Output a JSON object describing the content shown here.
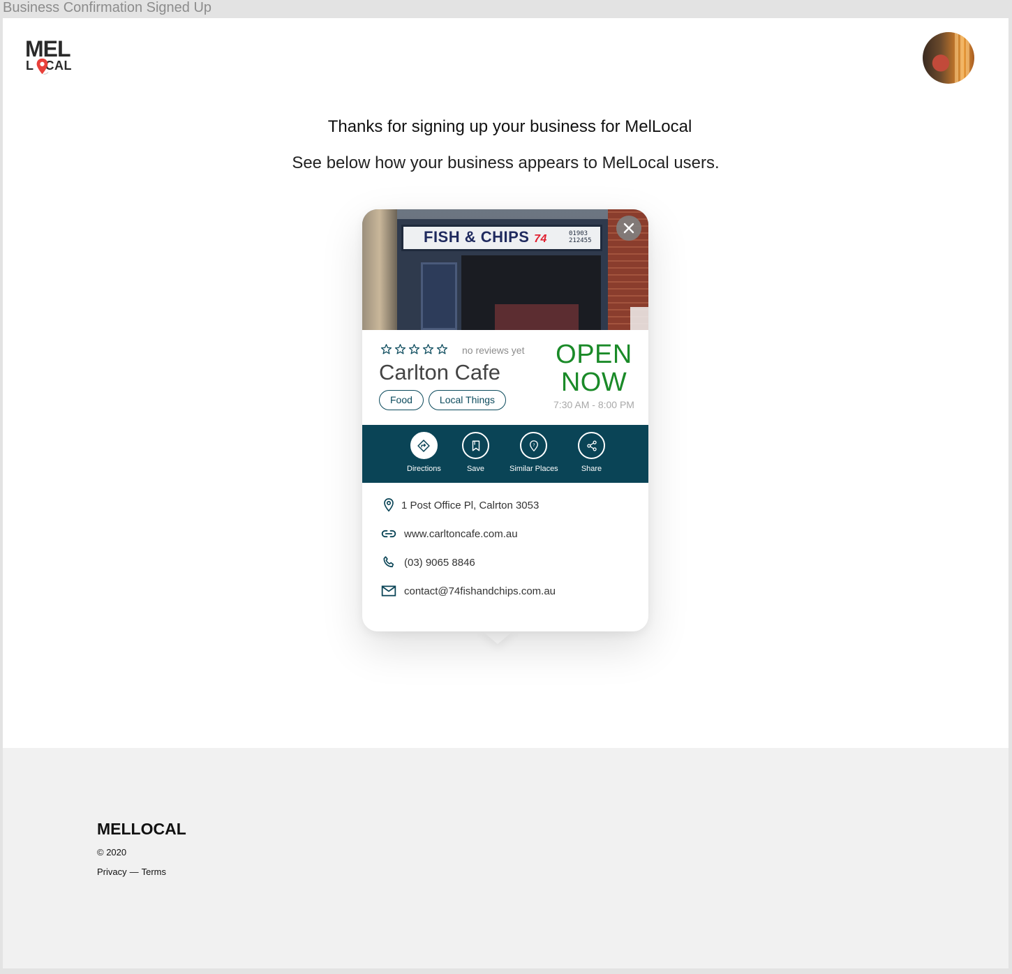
{
  "frame": {
    "title": "Business Confirmation Signed Up"
  },
  "header": {
    "logo": {
      "line1": "MEL",
      "line2_a": "L",
      "line2_b": "CAL",
      "pin_color": "#e8403a"
    }
  },
  "intro": {
    "heading": "Thanks for signing up your business for MelLocal",
    "subheading": "See below how your business appears to MelLocal users."
  },
  "card": {
    "photo": {
      "sign_text": "FISH & CHIPS",
      "sign_number": "74",
      "sign_phone_1": "01903",
      "sign_phone_2": "212455"
    },
    "rating": {
      "stars": 0,
      "max_stars": 5,
      "label": "no reviews yet"
    },
    "name": "Carlton Cafe",
    "tags": [
      "Food",
      "Local Things"
    ],
    "status": {
      "line1": "OPEN",
      "line2": "NOW",
      "hours": "7:30 AM - 8:00 PM",
      "color": "#1a8a28"
    },
    "actions": [
      {
        "label": "Directions",
        "icon": "directions-icon"
      },
      {
        "label": "Save",
        "icon": "bookmark-icon"
      },
      {
        "label": "Similar Places",
        "icon": "place-pin-icon"
      },
      {
        "label": "Share",
        "icon": "share-icon"
      }
    ],
    "action_bar_color": "#0a4456",
    "contact": {
      "address": "1 Post Office Pl, Calrton 3053",
      "website": "www.carltoncafe.com.au",
      "phone": "(03) 9065 8846",
      "email": "contact@74fishandchips.com.au"
    }
  },
  "footer": {
    "brand": "MELLOCAL",
    "copyright": "© 2020",
    "links": [
      "Privacy",
      "Terms"
    ],
    "separator": "—"
  }
}
